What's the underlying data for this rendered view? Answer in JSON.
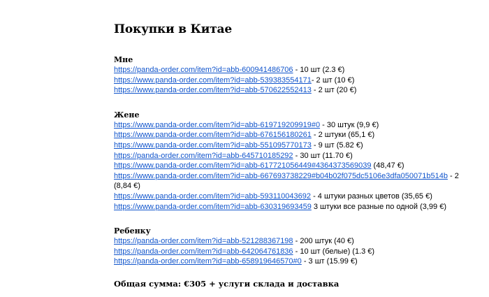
{
  "document": {
    "title": "Покупки в Китае",
    "sections": [
      {
        "heading": "Мне",
        "items": [
          {
            "url": "https://panda-order.com/item?id=abb-600941486706",
            "note": " - 10 шт (2.3 €)"
          },
          {
            "url": "https://www.panda-order.com/item?id=abb-539383554171",
            "note": "- 2 шт (10 €)"
          },
          {
            "url": "https://www.panda-order.com/item?id=abb-570622552413",
            "note": " - 2 шт (20 €)"
          }
        ]
      },
      {
        "heading": "Жене",
        "items": [
          {
            "url": "https://www.panda-order.com/item?id=abb-619719209919#0",
            "note": "  - 30 штук (9,9 €)"
          },
          {
            "url": "https://www.panda-order.com/item?id=abb-676156180261",
            "note": "  -  2 штуки (65,1 €)"
          },
          {
            "url": "https://www.panda-order.com/item?id=abb-551095770173",
            "note": "  - 9 шт  (5.82 €)"
          },
          {
            "url": "https://panda-order.com/item?id=abb-645710185292",
            "note": " - 30 шт (11.70 €)"
          },
          {
            "url": "https://www.panda-order.com/item?id=abb-617721056449#4364373569039",
            "note": " (48,47 €)"
          },
          {
            "url": "https://www.panda-order.com/item?id=abb-667693738229#b04b02f075dc5106e3dfa050071b514b",
            "note": " - 2 (8,84 €)"
          },
          {
            "url": "https://www.panda-order.com/item?id=abb-593110043692",
            "note": " - 4 штуки разных цветов (35,65 €)"
          },
          {
            "url": "https://www.panda-order.com/item?id=abb-630319693459",
            "note": " 3 штуки все разные по одной (3,99 €)"
          }
        ]
      },
      {
        "heading": "Ребенку",
        "items": [
          {
            "url": "https://panda-order.com/item?id=abb-521288367198",
            "note": "  - 200 штук (40 €)"
          },
          {
            "url": "https://panda-order.com/item?id=abb-642064761836",
            "note": " - 10 шт (белые) (1.3 €)"
          },
          {
            "url": "https://panda-order.com/item?id=abb-658919646570#0",
            "note": " - 3 шт (15.99 €)"
          }
        ]
      }
    ],
    "total": "Общая сумма: €305 + услуги склада и доставка"
  }
}
